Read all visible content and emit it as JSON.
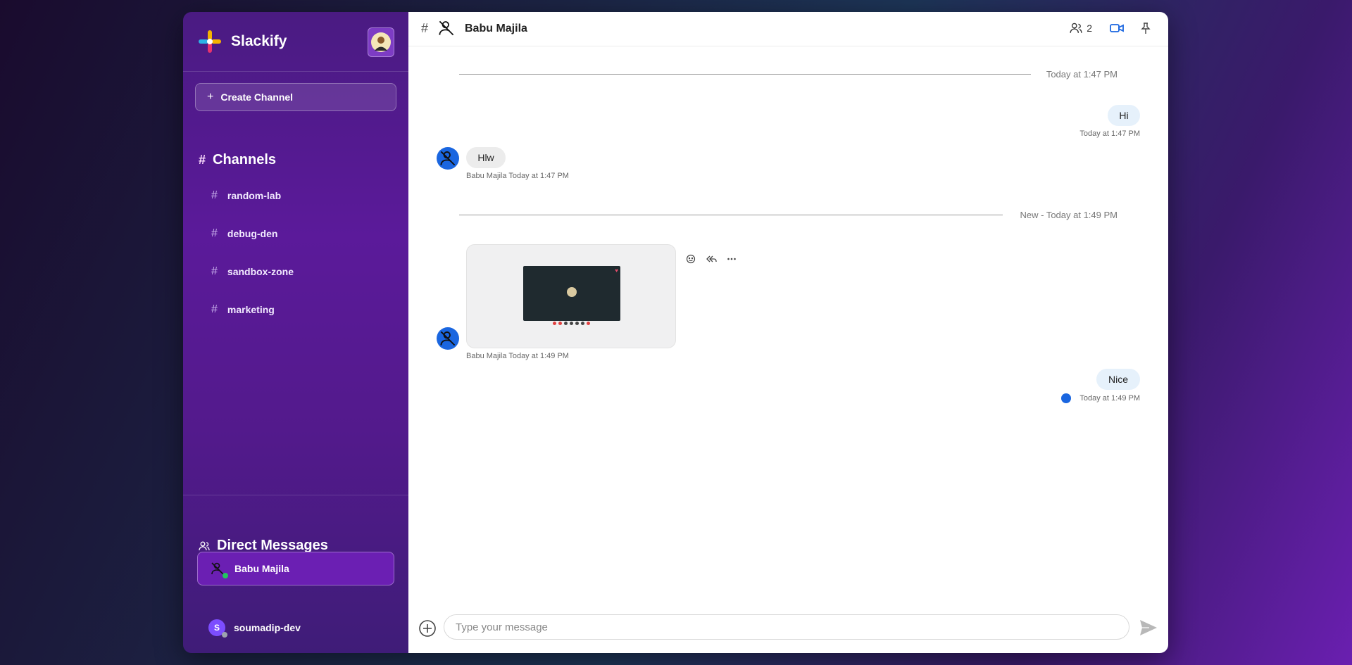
{
  "app": {
    "name": "Slackify",
    "accent": "#1a66e0"
  },
  "sidebar": {
    "create_label": "Create Channel",
    "channels_title": "Channels",
    "channels": [
      {
        "label": "random-lab"
      },
      {
        "label": "debug-den"
      },
      {
        "label": "sandbox-zone"
      },
      {
        "label": "marketing"
      }
    ],
    "dm_title": "Direct Messages",
    "dms": [
      {
        "label": "Babu Majila",
        "active": true,
        "status_color": "#22c55e"
      },
      {
        "label": "soumadip-dev",
        "initial": "S",
        "active": false,
        "status_color": "#9ca3af"
      }
    ]
  },
  "header": {
    "hash": "#",
    "title": "Babu Majila",
    "member_count": "2"
  },
  "messages": {
    "divider1": "Today at 1:47 PM",
    "msg_hi": {
      "text": "Hi",
      "meta": "Today at 1:47 PM"
    },
    "msg_hlw": {
      "text": "Hlw",
      "meta": "Babu Majila Today at 1:47 PM"
    },
    "divider2": "New - Today at 1:49 PM",
    "msg_img": {
      "meta": "Babu Majila Today at 1:49 PM"
    },
    "msg_nice": {
      "text": "Nice",
      "meta": "Today at 1:49 PM"
    }
  },
  "composer": {
    "placeholder": "Type your message"
  }
}
